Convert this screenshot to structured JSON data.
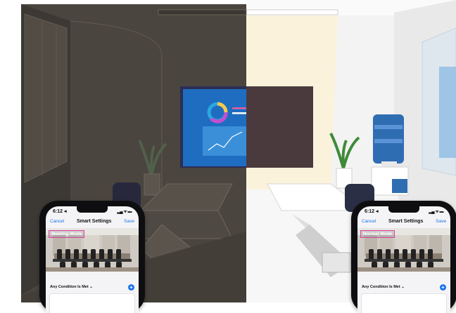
{
  "phones": [
    {
      "status_time": "6:12 ◂",
      "status_icons": "▂▄ ᯤ ▬",
      "nav_cancel": "Cancel",
      "nav_title": "Smart Settings",
      "nav_save": "Save",
      "mode_label": "Meeting Mode",
      "condition_label": "Any Condition Is Met",
      "condition_chevron": "⌄",
      "add_glyph": "+"
    },
    {
      "status_time": "6:12 ◂",
      "status_icons": "▂▄ ᯤ ▬",
      "nav_cancel": "Cancel",
      "nav_title": "Smart Settings",
      "nav_save": "Save",
      "mode_label": "Normal Mode",
      "condition_label": "Any Condition Is Met",
      "condition_chevron": "⌄",
      "add_glyph": "+"
    }
  ],
  "colors": {
    "accent": "#1a73e8",
    "highlight_box": "#e040a0",
    "dark_room": "#4a443e",
    "light_room": "#f2f2f2"
  },
  "icons": [
    "donut-chart-icon",
    "line-chart-icon",
    "plant-icon",
    "water-cooler-icon",
    "office-chair-icon",
    "laptop-icon"
  ]
}
